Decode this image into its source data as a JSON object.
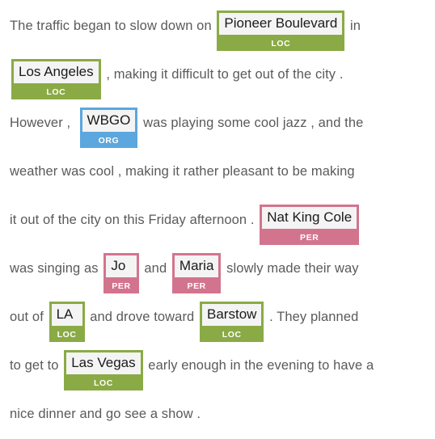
{
  "document": {
    "kind": "named-entity-recognition-annotation",
    "text_color": "#5a5a5a",
    "background": "#ffffff"
  },
  "entity_types": {
    "LOC": {
      "label": "LOC",
      "color": "#8aaa45",
      "name": "location"
    },
    "ORG": {
      "label": "ORG",
      "color": "#5ba7de",
      "name": "organization"
    },
    "PER": {
      "label": "PER",
      "color": "#d3748e",
      "name": "person"
    }
  },
  "lines": [
    {
      "id": "line-1",
      "parts": [
        {
          "kind": "text",
          "value": "The traffic began to slow down on "
        },
        {
          "kind": "entity",
          "value": "Pioneer Boulevard",
          "type": "LOC",
          "wide": true
        },
        {
          "kind": "text",
          "value": " in"
        }
      ]
    },
    {
      "id": "line-2",
      "parts": [
        {
          "kind": "entity",
          "value": "Los Angeles",
          "type": "LOC",
          "wide": true
        },
        {
          "kind": "text",
          "value": " , making it difficult to get out of the city ."
        }
      ]
    },
    {
      "id": "line-3",
      "parts": [
        {
          "kind": "text",
          "value": "However ,  "
        },
        {
          "kind": "entity",
          "value": "WBGO",
          "type": "ORG",
          "wide": true
        },
        {
          "kind": "text",
          "value": " was playing some cool jazz , and the"
        }
      ]
    },
    {
      "id": "line-4",
      "parts": [
        {
          "kind": "text",
          "value": "weather was cool , making it rather pleasant to be making"
        }
      ]
    },
    {
      "id": "line-5",
      "parts": [
        {
          "kind": "text",
          "value": "it out of the city on this Friday afternoon . "
        },
        {
          "kind": "entity",
          "value": "Nat King Cole",
          "type": "PER",
          "wide": true
        }
      ]
    },
    {
      "id": "line-6",
      "parts": [
        {
          "kind": "text",
          "value": "was singing as "
        },
        {
          "kind": "entity",
          "value": "Jo",
          "type": "PER",
          "wide": true
        },
        {
          "kind": "text",
          "value": " and "
        },
        {
          "kind": "entity",
          "value": "Maria",
          "type": "PER",
          "wide": false
        },
        {
          "kind": "text",
          "value": " slowly made their way"
        }
      ]
    },
    {
      "id": "line-7",
      "parts": [
        {
          "kind": "text",
          "value": "out of "
        },
        {
          "kind": "entity",
          "value": "LA",
          "type": "LOC",
          "wide": true
        },
        {
          "kind": "text",
          "value": " and drove toward "
        },
        {
          "kind": "entity",
          "value": "Barstow",
          "type": "LOC",
          "wide": false
        },
        {
          "kind": "text",
          "value": " . They planned"
        }
      ]
    },
    {
      "id": "line-8",
      "parts": [
        {
          "kind": "text",
          "value": "to get to "
        },
        {
          "kind": "entity",
          "value": "Las Vegas",
          "type": "LOC",
          "wide": false
        },
        {
          "kind": "text",
          "value": " early enough in the evening to have a"
        }
      ]
    },
    {
      "id": "line-9",
      "last": true,
      "parts": [
        {
          "kind": "text",
          "value": "nice dinner and go see a show ."
        }
      ]
    }
  ]
}
